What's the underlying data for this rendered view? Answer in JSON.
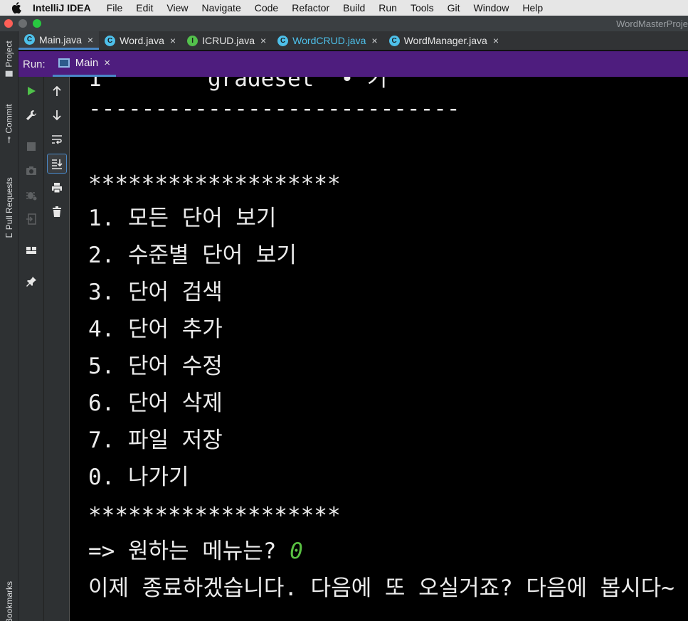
{
  "menubar": {
    "app_name": "IntelliJ IDEA",
    "items": [
      "File",
      "Edit",
      "View",
      "Navigate",
      "Code",
      "Refactor",
      "Build",
      "Run",
      "Tools",
      "Git",
      "Window",
      "Help"
    ]
  },
  "window": {
    "title": "WordMasterProje"
  },
  "tool_stripe": {
    "project": "Project",
    "commit": "Commit",
    "pull_requests": "Pull Requests",
    "bookmarks": "Bookmarks"
  },
  "tabs": [
    {
      "label": "Main.java",
      "icon": "class-icon",
      "letter": "C",
      "active": true
    },
    {
      "label": "Word.java",
      "icon": "class-icon",
      "letter": "C",
      "active": false
    },
    {
      "label": "ICRUD.java",
      "icon": "interface-icon",
      "letter": "I",
      "active": false
    },
    {
      "label": "WordCRUD.java",
      "icon": "class-icon",
      "letter": "C",
      "active": false
    },
    {
      "label": "WordManager.java",
      "icon": "class-icon",
      "letter": "C",
      "active": false
    }
  ],
  "run": {
    "label": "Run:",
    "tab_label": "Main"
  },
  "console": {
    "partial_top": "1        gradeset  • 기",
    "dashes": "----------------------------",
    "stars_top": "*******************",
    "menu": [
      "1. 모든 단어 보기",
      "2. 수준별 단어 보기",
      "3. 단어 검색",
      "4. 단어 추가",
      "5. 단어 수정",
      "6. 단어 삭제",
      "7. 파일 저장",
      "0. 나가기"
    ],
    "stars_bottom": "*******************",
    "prompt": "=> 원하는 메뉴는? ",
    "user_input": "0",
    "goodbye": "이제 종료하겠습니다. 다음에 또 오실거죠? 다음에 봅시다~"
  },
  "colors": {
    "run_bar": "#4e1d7e",
    "input_text": "#59c142",
    "accent": "#4a88c7"
  }
}
